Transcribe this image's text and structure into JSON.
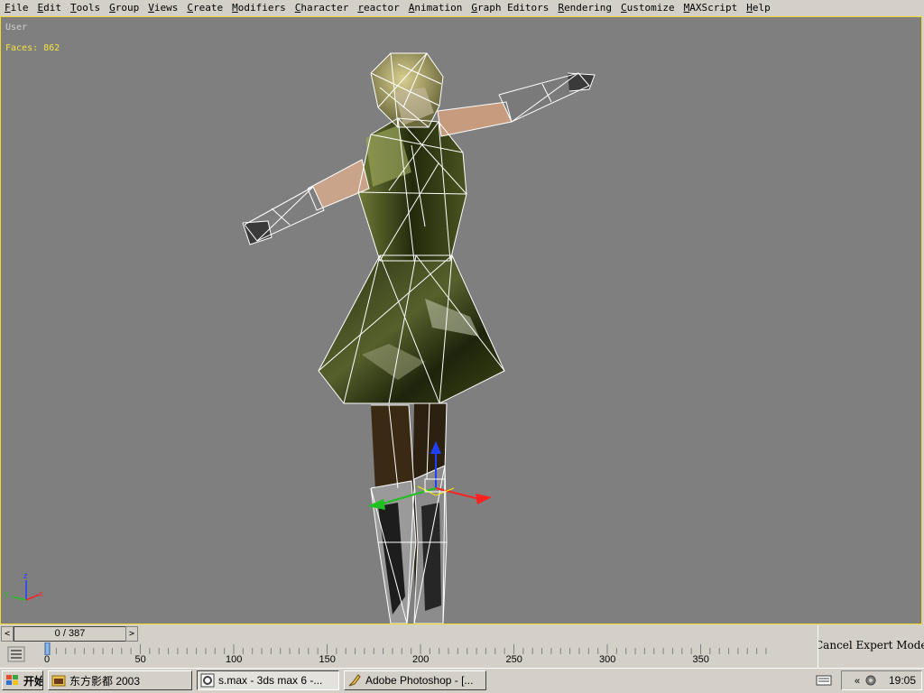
{
  "menu": [
    "File",
    "Edit",
    "Tools",
    "Group",
    "Views",
    "Create",
    "Modifiers",
    "Character",
    "reactor",
    "Animation",
    "Graph Editors",
    "Rendering",
    "Customize",
    "MAXScript",
    "Help"
  ],
  "viewport": {
    "label": "User",
    "faces": "Faces: 862"
  },
  "timeline": {
    "frame_display": "0 / 387",
    "tick_labels": [
      "0",
      "50",
      "100",
      "150",
      "200",
      "250",
      "300",
      "350"
    ],
    "left_arrow": "<",
    "right_arrow": ">"
  },
  "right_panel": {
    "text": "Cancel Expert Mode"
  },
  "taskbar": {
    "start_label": "开始",
    "apps": [
      {
        "label": "东方影都 2003"
      },
      {
        "label": "s.max - 3ds max 6 -..."
      },
      {
        "label": "Adobe Photoshop - [..."
      }
    ],
    "clock": "19:05"
  },
  "colors": {
    "viewport_bg": "#7f7f7f",
    "viewport_border": "#f2d92b",
    "faces_text": "#f5e43c",
    "chrome": "#d4d0c8"
  }
}
